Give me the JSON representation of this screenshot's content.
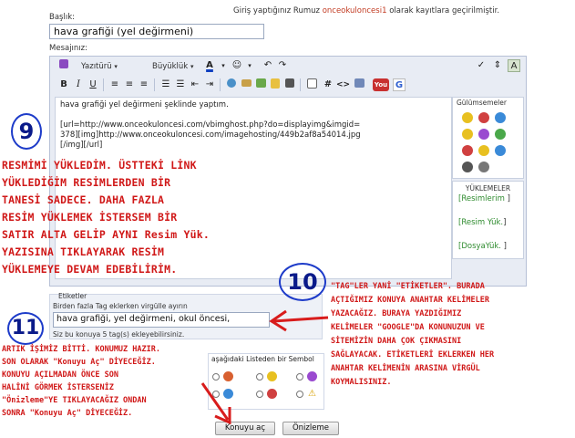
{
  "login": {
    "prefix": "Giriş yaptığınız Rumuz",
    "user": "onceokuloncesi1",
    "suffix": "olarak kayıtlara geçirilmiştir."
  },
  "form": {
    "title_label": "Başlık:",
    "title_value": "hava grafiği (yel değirmeni)",
    "message_label": "Mesajınız:"
  },
  "toolbar": {
    "font_label": "Yazıtürü",
    "size_label": "Büyüklük",
    "smiley_dropdown": "☺",
    "undo": "↶",
    "redo": "↷",
    "bold": "B",
    "italic": "I",
    "underline": "U",
    "hash": "#",
    "code": "<>",
    "youtube": "You",
    "google": "G"
  },
  "message": {
    "line1": "hava grafiği yel değirmeni şeklinde yaptım.",
    "line2": "[url=http://www.onceokuloncesi.com/vbimghost.php?do=displayimg&imgid=",
    "line3": "378][img]http://www.onceokuloncesi.com/imagehosting/449b2af8a54014.jpg",
    "line4": "[/img][/url]"
  },
  "smilies": {
    "title": "Gülümsemeler",
    "colors": [
      "#e8c020",
      "#d04040",
      "#3a8ad8",
      "#e8c020",
      "#9a4ad0",
      "#4aa84a",
      "#d04040",
      "#e8c020",
      "#3a8ad8",
      "#555555",
      "#777777"
    ]
  },
  "uploads": {
    "title": "YÜKLEMELER",
    "items": [
      "Resimlerim",
      "Resim Yük.",
      "DosyaYük."
    ]
  },
  "tags": {
    "section_label": "Etiketler",
    "hint": "Birden fazla Tag eklerken virgülle ayırın",
    "value": "hava grafiği, yel değirmeni, okul öncesi,",
    "limit_note": "Siz bu konuya 5 tag(s) ekleyebilirsiniz."
  },
  "icons": {
    "label": "aşağıdaki Listeden bir Sembol"
  },
  "buttons": {
    "submit": "Konuyu aç",
    "preview": "Önizleme"
  },
  "annotations": {
    "step9_number": "9",
    "step9_lines": [
      "RESMİMİ YÜKLEDİM. ÜSTTEKİ LİNK",
      "YÜKLEDİĞİM RESİMLERDEN BİR",
      "TANESİ SADECE. DAHA FAZLA",
      "RESİM YÜKLEMEK İSTERSEM BİR",
      "SATIR ALTA GELİP AYNI Resim Yük.",
      "YAZISINA TIKLAYARAK RESİM",
      "YÜKLEMEYE DEVAM EDEBİLİRİM."
    ],
    "step10_number": "10",
    "step10_lines": [
      "\"TAG\"LER YANİ \"ETİKETLER\". BURADA",
      "AÇTIĞIMIZ KONUYA ANAHTAR KELİMELER",
      "YAZACAĞIZ. BURAYA YAZDIĞIMIZ",
      "KELİMELER \"GOOGLE\"DA KONUNUZUN VE",
      "SİTEMİZİN DAHA ÇOK ÇIKMASINI",
      "SAĞLAYACAK. ETİKETLERİ EKLERKEN HER",
      "ANAHTAR KELİMENİN ARASINA VİRGÜL",
      "KOYMALISINIZ."
    ],
    "step11_number": "11",
    "step11_lines": [
      "ARTIK İŞİMİZ BİTTİ. KONUMUZ HAZIR.",
      "SON OLARAK \"Konuyu Aç\" DİYECEĞİZ.",
      "KONUYU AÇILMADAN ÖNCE SON",
      "HALİNİ GÖRMEK İSTERSENİZ",
      "\"Önizleme\"YE TIKLAYACAĞIZ ONDAN",
      "SONRA \"Konuyu Aç\" DİYECEĞİZ."
    ]
  },
  "colors": {
    "annotation_red": "#d01818",
    "circle_blue": "#1d3bc9",
    "arrow_red": "#d81c1c",
    "link_green": "#2e8b2e"
  }
}
